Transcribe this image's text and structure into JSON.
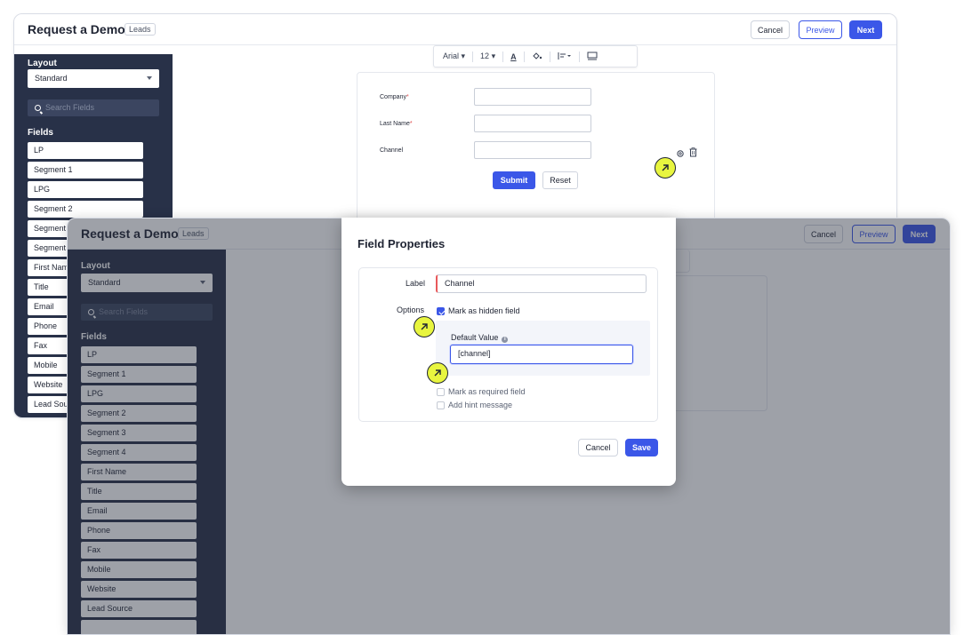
{
  "editor": {
    "title": "Request a Demo",
    "badge": "Leads",
    "buttons": {
      "cancel": "Cancel",
      "preview": "Preview",
      "next": "Next"
    }
  },
  "sidebar": {
    "layout_label": "Layout",
    "layout_value": "Standard",
    "search_placeholder": "Search Fields",
    "fields_label": "Fields",
    "fields": [
      "LP",
      "Segment 1",
      "LPG",
      "Segment 2",
      "Segment 3",
      "Segment 4",
      "First Name",
      "Title",
      "Email",
      "Phone",
      "Fax",
      "Mobile",
      "Website",
      "Lead Source"
    ]
  },
  "toolbar": {
    "font": "Arial",
    "size": "12"
  },
  "form": {
    "fields": [
      {
        "label": "Company",
        "required": true
      },
      {
        "label": "Last Name",
        "required": true
      },
      {
        "label": "Channel",
        "required": false
      }
    ],
    "submit": "Submit",
    "reset": "Reset"
  },
  "modal": {
    "title": "Field Properties",
    "label_caption": "Label",
    "label_value": "Channel",
    "options_caption": "Options",
    "hidden_field": "Mark as hidden field",
    "hidden_checked": true,
    "default_value_label": "Default Value",
    "default_value": "[channel]",
    "required_field": "Mark as required field",
    "required_checked": false,
    "hint_message": "Add hint message",
    "hint_checked": false,
    "cancel": "Cancel",
    "save": "Save"
  },
  "colors": {
    "accent": "#3b57e8",
    "sidebar": "#283148",
    "highlight": "#e8f53f",
    "required": "#e04b4b"
  },
  "icons": [
    "search-icon",
    "chevron-down-icon",
    "font-color-icon",
    "fill-color-icon",
    "align-icon",
    "layout-icon",
    "gear-icon",
    "trash-icon",
    "cursor-arrow-icon",
    "info-icon",
    "checkbox-icon"
  ]
}
